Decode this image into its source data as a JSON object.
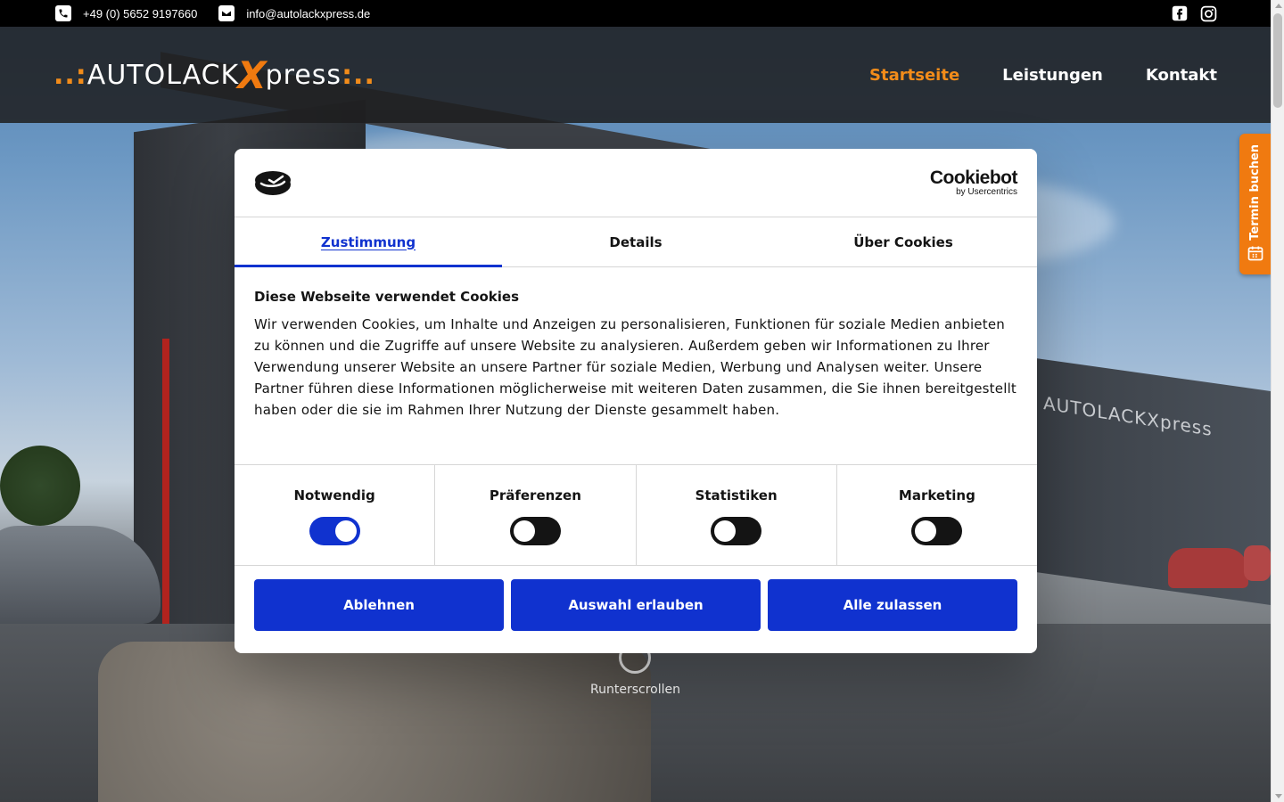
{
  "topbar": {
    "phone": "+49 (0) 5652 9197660",
    "email": "info@autolackxpress.de"
  },
  "header": {
    "logo": {
      "prefix_dots": "..:",
      "word1": "AUTOLACK",
      "x": "X",
      "word2": "press",
      "suffix_dots": ":.."
    },
    "nav": [
      {
        "label": "Startseite",
        "active": true
      },
      {
        "label": "Leistungen",
        "active": false
      },
      {
        "label": "Kontakt",
        "active": false
      }
    ]
  },
  "side_tab": {
    "label": "Termin buchen"
  },
  "background": {
    "sign_text": "AUTOLACKXpress"
  },
  "scroll_hint": {
    "label": "Runterscrollen"
  },
  "cookie_dialog": {
    "brand": {
      "name": "Cookiebot",
      "sub": "by Usercentrics"
    },
    "tabs": [
      {
        "label": "Zustimmung",
        "active": true
      },
      {
        "label": "Details",
        "active": false
      },
      {
        "label": "Über Cookies",
        "active": false
      }
    ],
    "title": "Diese Webseite verwendet Cookies",
    "text": "Wir verwenden Cookies, um Inhalte und Anzeigen zu personalisieren, Funktionen für soziale Medien anbieten zu können und die Zugriffe auf unsere Website zu analysieren. Außerdem geben wir Informationen zu Ihrer Verwendung unserer Website an unsere Partner für soziale Medien, Werbung und Analysen weiter. Unsere Partner führen diese Informationen möglicherweise mit weiteren Daten zusammen, die Sie ihnen bereitgestellt haben oder die sie im Rahmen Ihrer Nutzung der Dienste gesammelt haben.",
    "toggles": [
      {
        "label": "Notwendig",
        "on": true
      },
      {
        "label": "Präferenzen",
        "on": false
      },
      {
        "label": "Statistiken",
        "on": false
      },
      {
        "label": "Marketing",
        "on": false
      }
    ],
    "buttons": {
      "decline": "Ablehnen",
      "allow_selection": "Auswahl erlauben",
      "allow_all": "Alle zulassen"
    }
  },
  "colors": {
    "accent_orange": "#f28c1a",
    "cookie_blue": "#1032cf",
    "topbar_bg": "#000000"
  }
}
